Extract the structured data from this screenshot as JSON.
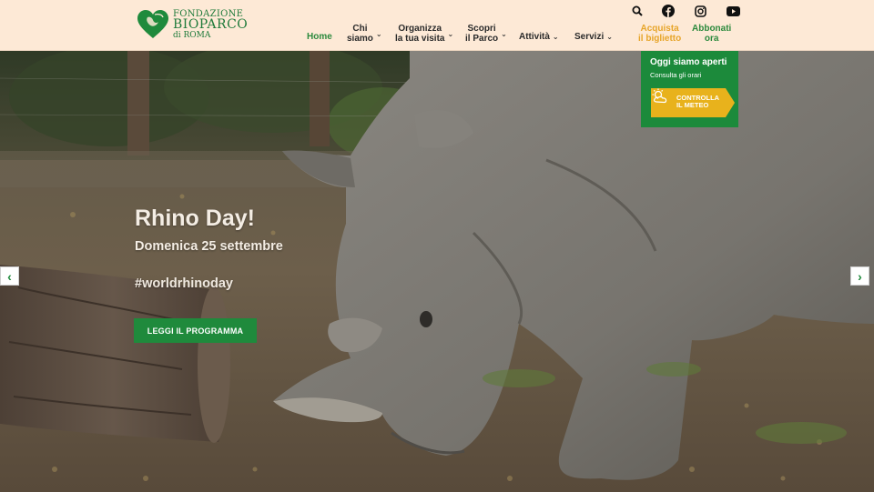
{
  "logo": {
    "line1": "FONDAZIONE",
    "line2": "BIOPARCO",
    "line3": "di ROMA"
  },
  "social": [
    {
      "name": "search-icon"
    },
    {
      "name": "facebook-icon"
    },
    {
      "name": "instagram-icon"
    },
    {
      "name": "youtube-icon"
    }
  ],
  "nav": {
    "home": "Home",
    "chi_1": "Chi",
    "chi_2": "siamo",
    "org_1": "Organizza",
    "org_2": "la tua visita",
    "scopri_1": "Scopri",
    "scopri_2": "il Parco",
    "attivita": "Attività",
    "servizi": "Servizi",
    "ticket_1": "Acquista",
    "ticket_2": "il biglietto",
    "sub_1": "Abbonati",
    "sub_2": "ora",
    "chevron": "⌄"
  },
  "hero": {
    "title": "Rhino Day!",
    "subtitle": "Domenica 25 settembre",
    "hashtag": "#worldrhinoday",
    "button": "LEGGI IL PROGRAMMA",
    "prev": "‹",
    "next": "›"
  },
  "info": {
    "title": "Oggi siamo aperti",
    "link": "Consulta gli orari",
    "meteo_1": "CONTROLLA",
    "meteo_2": "IL METEO"
  },
  "colors": {
    "header_bg": "#fde9d6",
    "brand_green": "#1f8a3c",
    "ticket_orange": "#e7a52a",
    "meteo_yellow": "#e8b21c"
  }
}
